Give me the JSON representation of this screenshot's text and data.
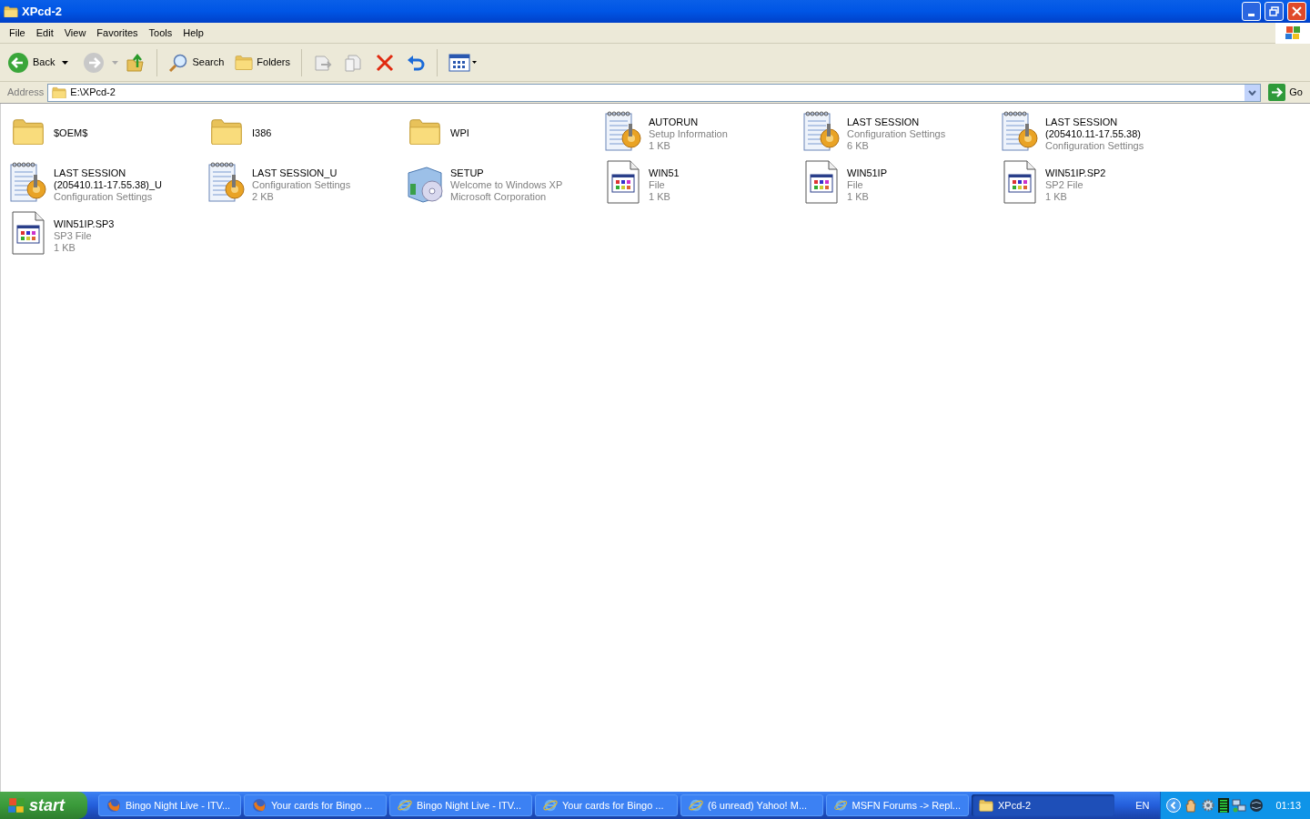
{
  "window": {
    "title": "XPcd-2"
  },
  "menu": [
    "File",
    "Edit",
    "View",
    "Favorites",
    "Tools",
    "Help"
  ],
  "toolbar": {
    "back": "Back",
    "search": "Search",
    "folders": "Folders"
  },
  "address": {
    "label": "Address",
    "value": "E:\\XPcd-2",
    "go": "Go"
  },
  "files": [
    {
      "kind": "folder",
      "name": "$OEM$"
    },
    {
      "kind": "folder",
      "name": "I386"
    },
    {
      "kind": "folder",
      "name": "WPI"
    },
    {
      "kind": "config",
      "name": "AUTORUN",
      "details": [
        "Setup Information",
        "1 KB"
      ]
    },
    {
      "kind": "config",
      "name": "LAST SESSION",
      "details": [
        "Configuration Settings",
        "6 KB"
      ]
    },
    {
      "kind": "config",
      "name": "LAST SESSION (205410.11-17.55.38)",
      "details": [
        "Configuration Settings"
      ]
    },
    {
      "kind": "config",
      "name": "LAST SESSION (205410.11-17.55.38)_U",
      "details": [
        "Configuration Settings"
      ]
    },
    {
      "kind": "config",
      "name": "LAST SESSION_U",
      "details": [
        "Configuration Settings",
        "2 KB"
      ]
    },
    {
      "kind": "setup",
      "name": "SETUP",
      "details": [
        "Welcome to Windows XP",
        "Microsoft Corporation"
      ]
    },
    {
      "kind": "file",
      "name": "WIN51",
      "details": [
        "File",
        "1 KB"
      ]
    },
    {
      "kind": "file",
      "name": "WIN51IP",
      "details": [
        "File",
        "1 KB"
      ]
    },
    {
      "kind": "file",
      "name": "WIN51IP.SP2",
      "details": [
        "SP2 File",
        "1 KB"
      ]
    },
    {
      "kind": "file",
      "name": "WIN51IP.SP3",
      "details": [
        "SP3 File",
        "1 KB"
      ]
    }
  ],
  "taskbar": {
    "start": "start",
    "items": [
      {
        "kind": "firefox",
        "label": "Bingo Night Live - ITV...",
        "selected": false
      },
      {
        "kind": "firefox",
        "label": "Your cards for Bingo ...",
        "selected": false
      },
      {
        "kind": "ie",
        "label": "Bingo Night Live - ITV...",
        "selected": false
      },
      {
        "kind": "ie",
        "label": "Your cards for Bingo ...",
        "selected": false
      },
      {
        "kind": "ie",
        "label": "(6 unread) Yahoo! M...",
        "selected": false
      },
      {
        "kind": "ie",
        "label": "MSFN Forums -> Repl...",
        "selected": false
      },
      {
        "kind": "folder",
        "label": "XPcd-2",
        "selected": true
      }
    ],
    "language": "EN",
    "clock": "01:13"
  }
}
